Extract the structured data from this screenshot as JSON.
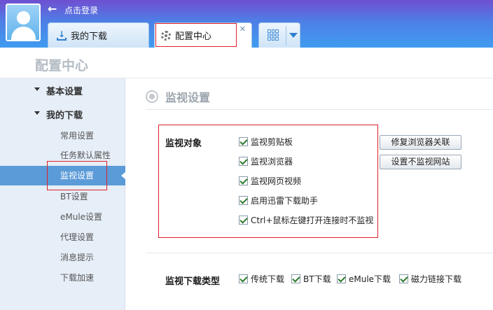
{
  "header": {
    "login_text": "点击登录",
    "tabs": [
      {
        "label": "我的下载"
      },
      {
        "label": "配置中心",
        "close": "✕"
      }
    ]
  },
  "page_title": "配置中心",
  "sidebar": {
    "groups": [
      {
        "label": "基本设置"
      },
      {
        "label": "我的下载"
      }
    ],
    "items": [
      {
        "label": "常用设置"
      },
      {
        "label": "任务默认属性"
      },
      {
        "label": "监视设置",
        "active": true
      },
      {
        "label": "BT设置"
      },
      {
        "label": "eMule设置"
      },
      {
        "label": "代理设置"
      },
      {
        "label": "消息提示"
      },
      {
        "label": "下载加速"
      }
    ]
  },
  "main": {
    "section_title": "监视设置",
    "monitor_objects": {
      "label": "监视对象",
      "options": [
        {
          "label": "监视剪贴板",
          "checked": true
        },
        {
          "label": "监视浏览器",
          "checked": true
        },
        {
          "label": "监视网页视频",
          "checked": true
        },
        {
          "label": "启用迅雷下载助手",
          "checked": true
        },
        {
          "label": "Ctrl+鼠标左键打开连接时不监视",
          "checked": true
        }
      ],
      "buttons": [
        {
          "label": "修复浏览器关联"
        },
        {
          "label": "设置不监视网站"
        }
      ]
    },
    "monitor_types": {
      "label": "监视下载类型",
      "options": [
        {
          "label": "传统下载",
          "checked": true
        },
        {
          "label": "BT下载",
          "checked": true
        },
        {
          "label": "eMule下载",
          "checked": true
        },
        {
          "label": "磁力链接下载",
          "checked": true
        }
      ]
    }
  },
  "colors": {
    "header_start": "#6f4fd0",
    "header_end": "#3f9cf0",
    "sidebar_bg": "#e6eef7",
    "active_item": "#5b9bd8",
    "annotation_red": "#e0202a"
  }
}
